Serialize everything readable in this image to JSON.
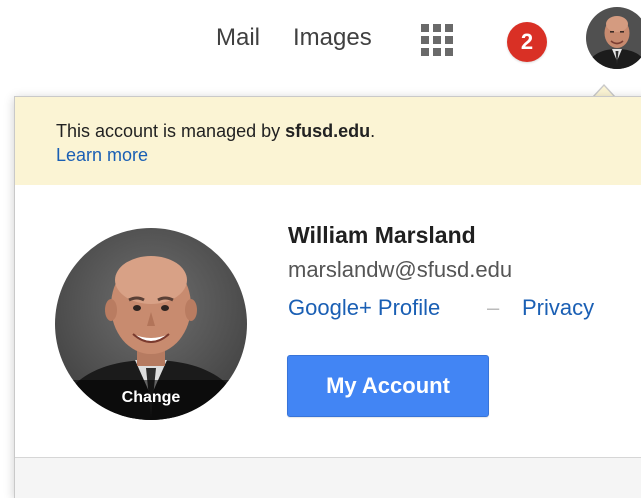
{
  "topbar": {
    "mail_label": "Mail",
    "images_label": "Images",
    "apps_icon": "apps-grid-icon",
    "notification_count": "2",
    "notification_color": "#d93025"
  },
  "account_popup": {
    "banner": {
      "text_prefix": "This account is managed by ",
      "domain": "sfusd.edu",
      "text_suffix": ".",
      "learn_more_label": "Learn more"
    },
    "avatar_change_label": "Change",
    "user_name": "William Marsland",
    "user_email": "marslandw@sfusd.edu",
    "profile_link_label": "Google+ Profile",
    "separator": "–",
    "privacy_link_label": "Privacy",
    "my_account_button_label": "My Account",
    "accent_color": "#4285f4",
    "banner_color": "#fbf4d4"
  }
}
